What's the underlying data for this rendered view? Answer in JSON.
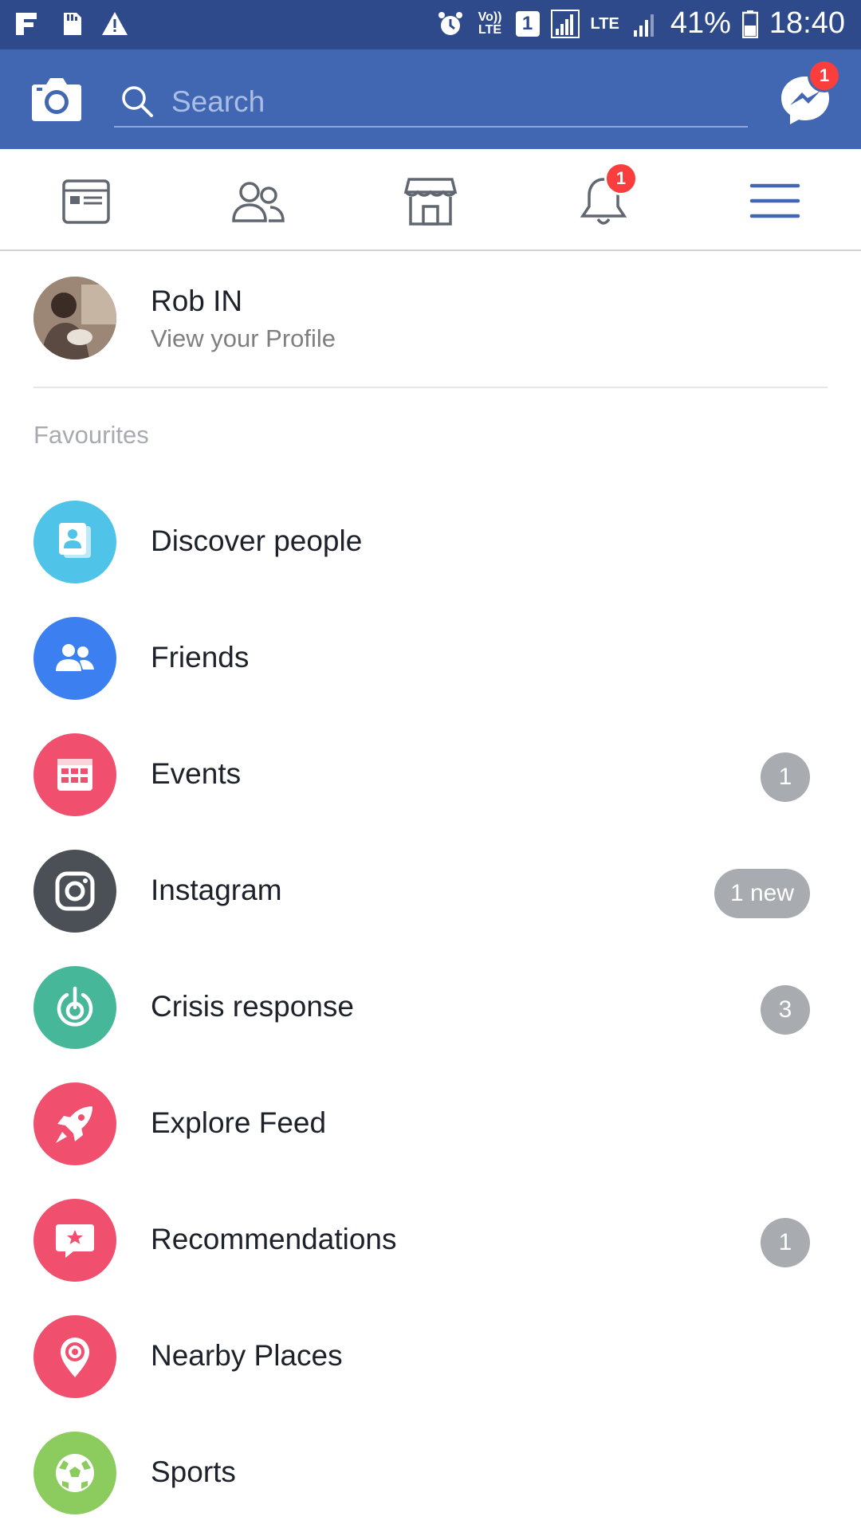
{
  "status_bar": {
    "volte": "Vo)) LTE",
    "sim": "1",
    "lte": "LTE",
    "battery": "41%",
    "time": "18:40"
  },
  "header": {
    "search_placeholder": "Search",
    "messenger_badge": "1"
  },
  "tabs": {
    "notifications_badge": "1"
  },
  "profile": {
    "name": "Rob IN",
    "subtitle": "View your Profile"
  },
  "favourites": {
    "title": "Favourites",
    "items": [
      {
        "label": "Discover people",
        "icon": "discover-people-icon",
        "color": "#4fc3e8",
        "badge": ""
      },
      {
        "label": "Friends",
        "icon": "friends-icon",
        "color": "#3b7ff0",
        "badge": ""
      },
      {
        "label": "Events",
        "icon": "calendar-icon",
        "color": "#f0506e",
        "badge": "1"
      },
      {
        "label": "Instagram",
        "icon": "instagram-icon",
        "color": "#4b4f56",
        "badge": "1 new"
      },
      {
        "label": "Crisis response",
        "icon": "crisis-response-icon",
        "color": "#46b899",
        "badge": "3"
      },
      {
        "label": "Explore Feed",
        "icon": "rocket-icon",
        "color": "#f0506e",
        "badge": ""
      },
      {
        "label": "Recommendations",
        "icon": "recommendation-star-icon",
        "color": "#f0506e",
        "badge": "1"
      },
      {
        "label": "Nearby Places",
        "icon": "location-pin-icon",
        "color": "#f0506e",
        "badge": ""
      },
      {
        "label": "Sports",
        "icon": "soccer-ball-icon",
        "color": "#8ccc5e",
        "badge": ""
      }
    ]
  },
  "colors": {
    "status_bar": "#2f4a8a",
    "header": "#4267b2",
    "active_tab": "#4267b2",
    "badge_gray": "#a8abaf",
    "badge_red": "#fa3e3e"
  }
}
